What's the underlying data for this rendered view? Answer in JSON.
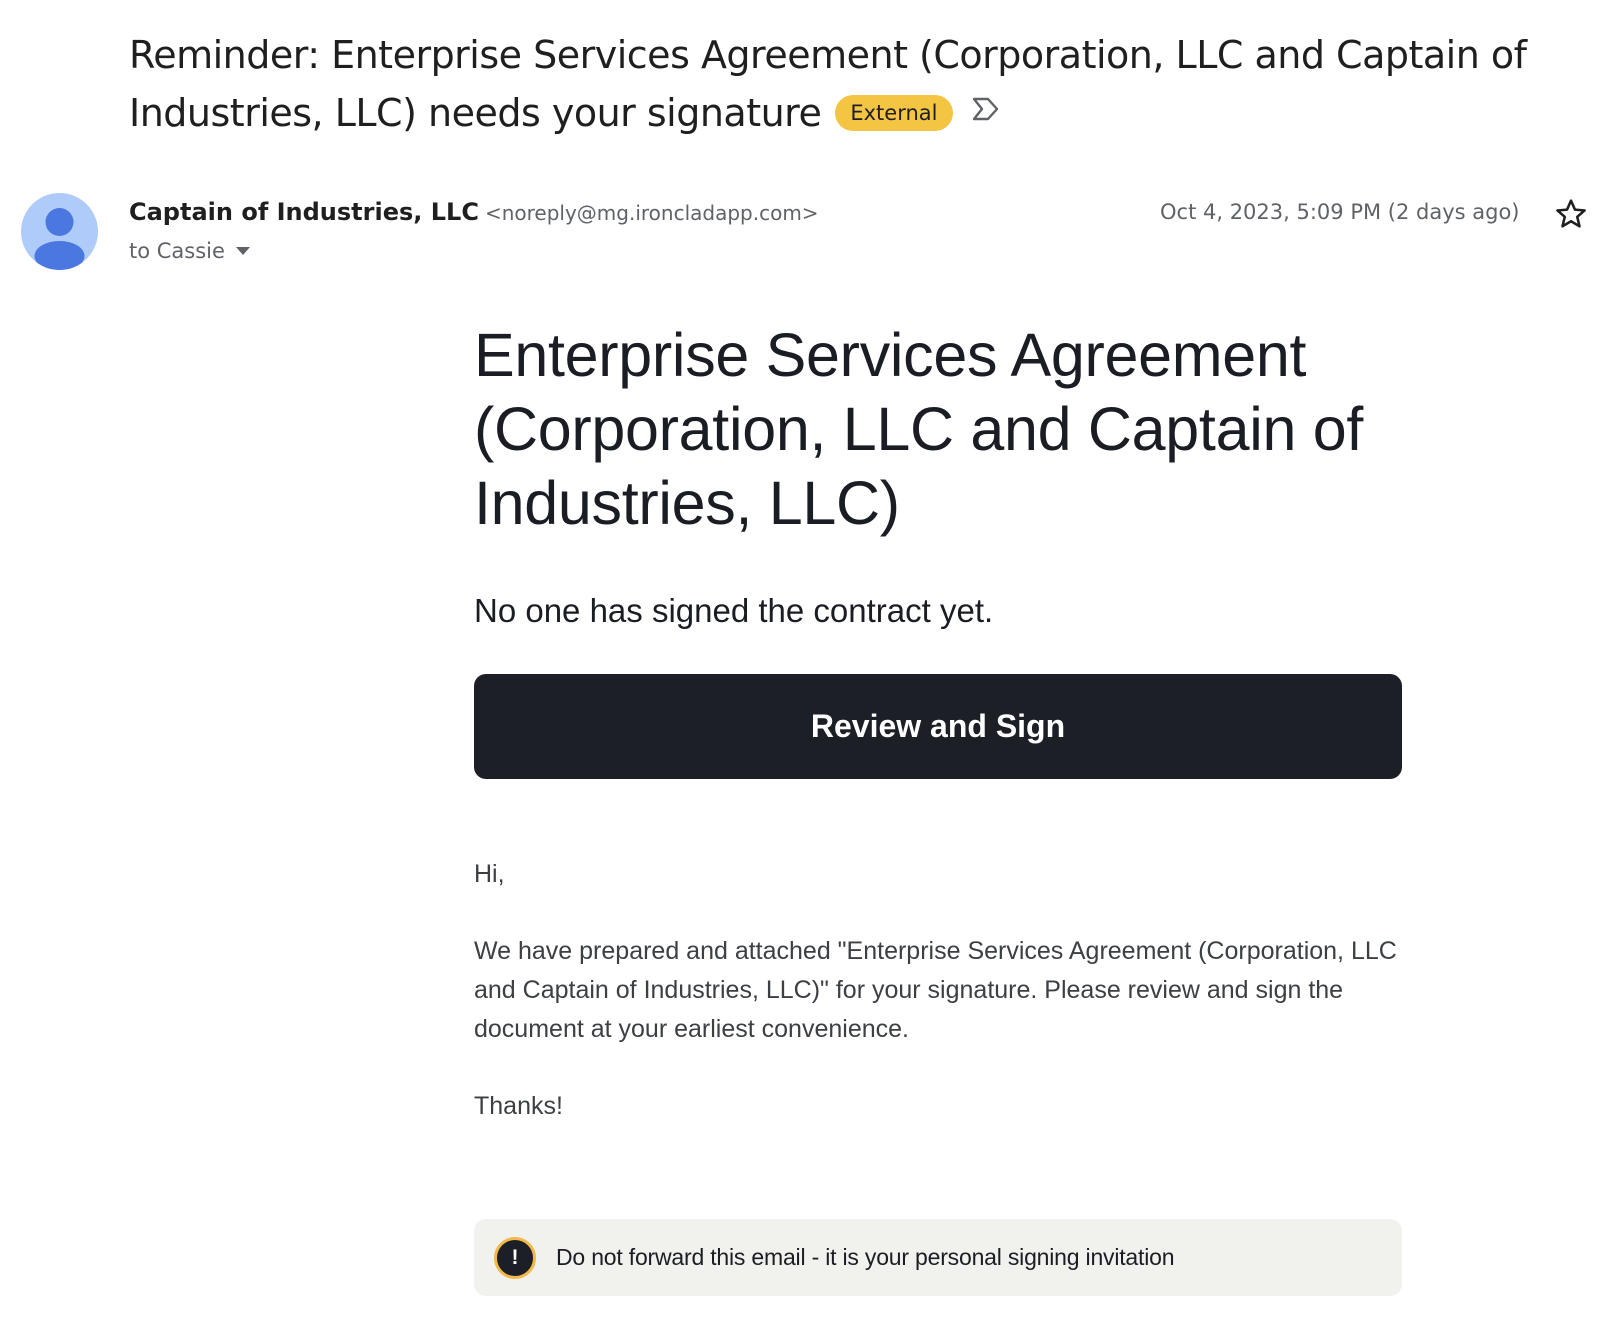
{
  "email": {
    "subject": "Reminder: Enterprise Services Agreement (Corporation, LLC and Captain of Industries, LLC) needs your signature",
    "badge": "External",
    "sender_name": "Captain of Industries, LLC",
    "sender_email": "<noreply@mg.ironcladapp.com>",
    "recipient": "to Cassie",
    "date": "Oct 4, 2023, 5:09 PM (2 days ago)"
  },
  "body": {
    "title": "Enterprise Services Agreement (Corporation, LLC and Captain of Industries, LLC)",
    "status": "No one has signed the contract yet.",
    "cta_label": "Review and Sign",
    "greeting": "Hi,",
    "message": "We have prepared and attached \"Enterprise Services Agreement (Corporation, LLC and Captain of Industries, LLC)\" for your signature. Please review and sign the document at your earliest convenience.",
    "closing": "Thanks!",
    "warning_icon": "!",
    "warning": "Do not forward this email - it is your personal signing invitation"
  },
  "icons": {
    "label": "label-outline-icon",
    "avatar": "person-icon",
    "recipient_dropdown": "caret-down-icon",
    "star": "star-outline-icon",
    "warning": "exclamation-circle-icon"
  },
  "colors": {
    "badge": "#f4c542",
    "button": "#1c1f26",
    "avatar": "#aecbfa",
    "warning_bg": "#f1f1ee"
  }
}
